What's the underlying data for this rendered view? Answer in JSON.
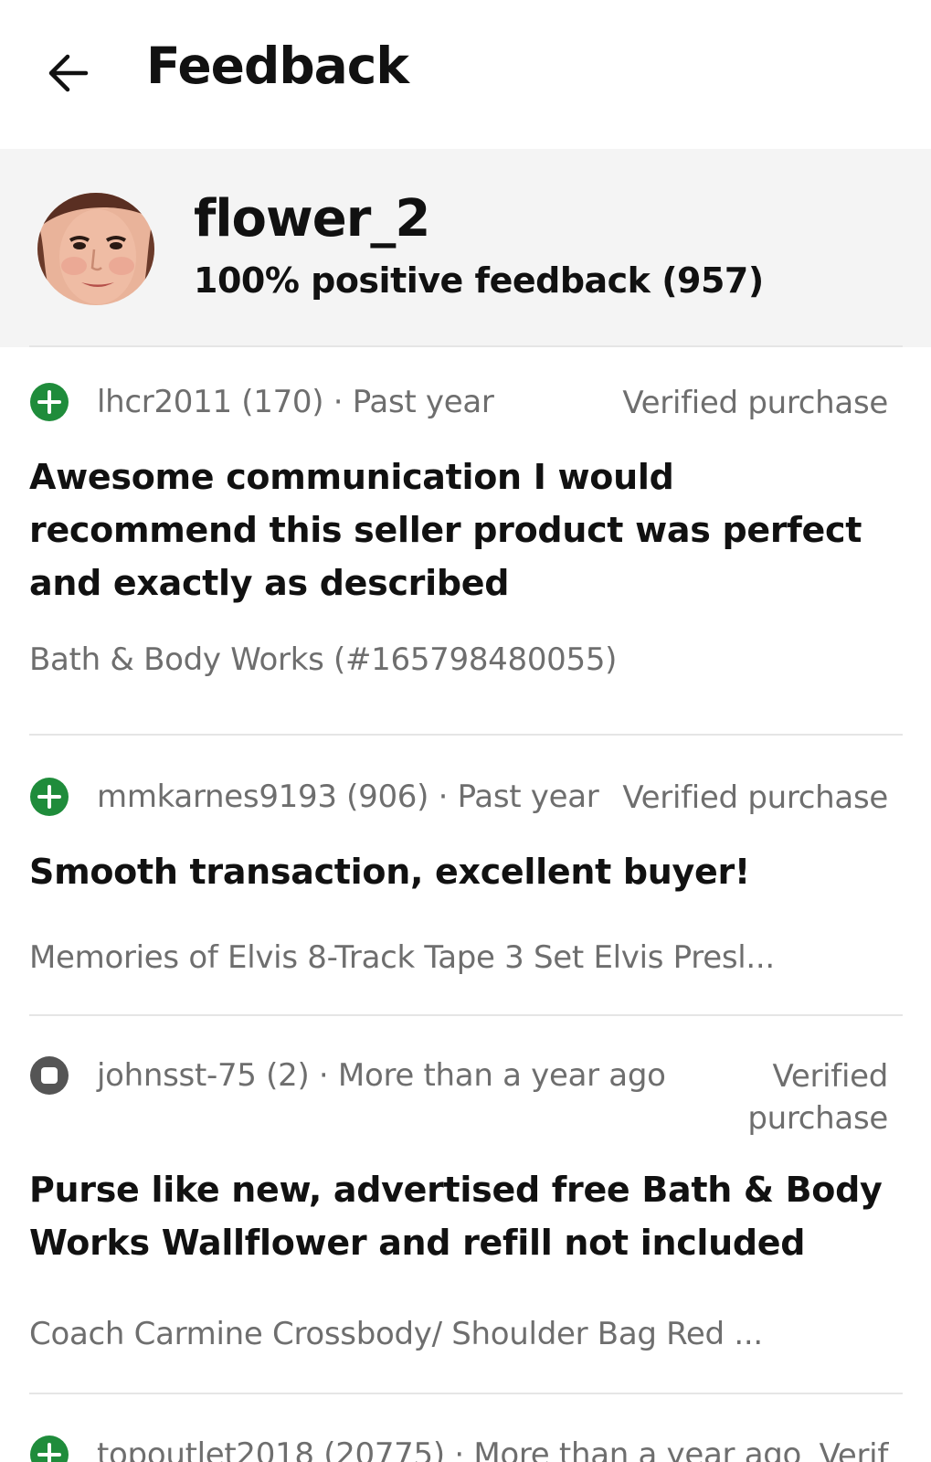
{
  "header": {
    "title": "Feedback"
  },
  "profile": {
    "username": "flower_2",
    "score_text": "100% positive feedback (957)"
  },
  "feedback": [
    {
      "type": "positive",
      "meta": "lhcr2011 (170) · Past year",
      "verified": "Verified purchase",
      "comment": "Awesome communication I would recommend this seller product was perfect and exactly as described",
      "item": "Bath & Body Works  (#165798480055)"
    },
    {
      "type": "positive",
      "meta": "mmkarnes9193 (906) · Past year",
      "verified": "Verified purchase",
      "comment": "Smooth transaction, excellent buyer!",
      "item": "Memories of Elvis 8-Track Tape 3 Set Elvis Presl..."
    },
    {
      "type": "neutral",
      "meta": "johnsst-75 (2) · More than a year ago",
      "verified_line1": "Verified",
      "verified_line2": "purchase",
      "comment": "Purse like new, advertised free Bath & Body Works Wallflower and refill not included",
      "item": "Coach Carmine Crossbody/ Shoulder Bag Red ..."
    },
    {
      "type": "positive",
      "meta": "topoutlet2018 (20775) · More than a year ago",
      "verified": "Verif"
    }
  ],
  "icons": {
    "back": "arrow-left-icon",
    "positive": "plus-circle-icon",
    "neutral": "minus-circle-icon"
  },
  "colors": {
    "positive": "#1f8c3b",
    "neutral": "#555555",
    "muted_text": "#6e6e6e",
    "profile_bg": "#f4f4f4"
  }
}
